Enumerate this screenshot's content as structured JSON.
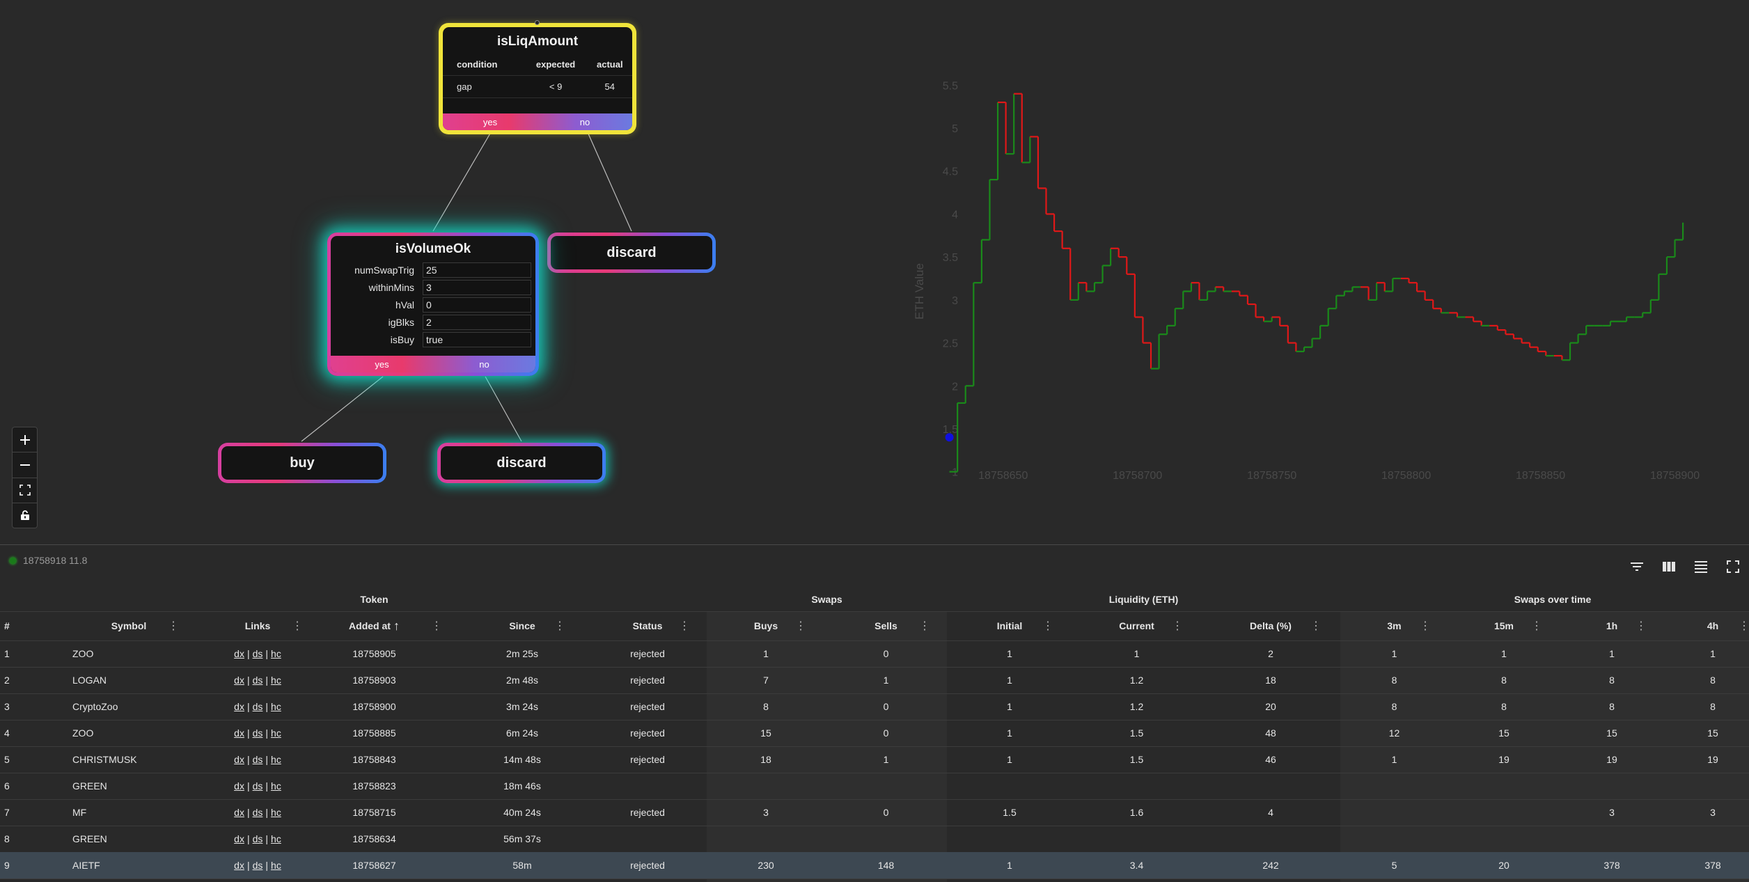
{
  "flow": {
    "root": {
      "title": "isLiqAmount",
      "columns": [
        "condition",
        "expected",
        "actual"
      ],
      "rows": [
        [
          "gap",
          "< 9",
          "54"
        ]
      ],
      "yes": "yes",
      "no": "no"
    },
    "volume": {
      "title": "isVolumeOk",
      "params": [
        {
          "label": "numSwapTrig",
          "value": "25"
        },
        {
          "label": "withinMins",
          "value": "3"
        },
        {
          "label": "hVal",
          "value": "0"
        },
        {
          "label": "igBlks",
          "value": "2"
        },
        {
          "label": "isBuy",
          "value": "true"
        }
      ],
      "yes": "yes",
      "no": "no"
    },
    "discard_top": "discard",
    "buy": "buy",
    "discard_bottom": "discard",
    "controls": [
      "plus-icon",
      "minus-icon",
      "fit-view-icon",
      "lock-icon"
    ]
  },
  "chart_data": {
    "type": "line",
    "style": "step",
    "ylabel": "ETH Value",
    "xlabel": "",
    "xlim": [
      18758627,
      18758918
    ],
    "ylim": [
      0.9,
      5.6
    ],
    "yticks": [
      "5.5",
      "5",
      "4.5",
      "4",
      "3.5",
      "3",
      "2.5",
      "2",
      "1.5",
      "1"
    ],
    "xticks": [
      "18758650",
      "18758700",
      "18758750",
      "18758800",
      "18758850",
      "18758900"
    ],
    "colors": {
      "up": "#1a8a1a",
      "down": "#e01818",
      "marker": "#1010e0"
    },
    "marker": {
      "x": 18758630,
      "y": 1.4
    },
    "x": [
      18758630,
      18758633,
      18758636,
      18758639,
      18758642,
      18758645,
      18758648,
      18758651,
      18758654,
      18758657,
      18758660,
      18758663,
      18758666,
      18758669,
      18758672,
      18758675,
      18758678,
      18758681,
      18758684,
      18758687,
      18758690,
      18758693,
      18758696,
      18758699,
      18758702,
      18758705,
      18758708,
      18758711,
      18758714,
      18758717,
      18758720,
      18758723,
      18758726,
      18758729,
      18758732,
      18758735,
      18758738,
      18758741,
      18758744,
      18758747,
      18758750,
      18758753,
      18758756,
      18758759,
      18758762,
      18758765,
      18758768,
      18758771,
      18758774,
      18758777,
      18758780,
      18758783,
      18758786,
      18758789,
      18758792,
      18758795,
      18758798,
      18758801,
      18758804,
      18758807,
      18758810,
      18758813,
      18758816,
      18758819,
      18758822,
      18758825,
      18758828,
      18758831,
      18758834,
      18758837,
      18758840,
      18758843,
      18758846,
      18758849,
      18758852,
      18758855,
      18758858,
      18758861,
      18758864,
      18758867,
      18758870,
      18758873,
      18758876,
      18758879,
      18758882,
      18758885,
      18758888,
      18758891,
      18758894,
      18758897,
      18758900,
      18758903
    ],
    "values": [
      1.0,
      1.8,
      2.0,
      3.2,
      3.7,
      4.4,
      5.3,
      4.7,
      5.4,
      4.6,
      4.9,
      4.3,
      4.0,
      3.8,
      3.6,
      3.0,
      3.2,
      3.1,
      3.2,
      3.4,
      3.6,
      3.5,
      3.3,
      2.8,
      2.5,
      2.2,
      2.6,
      2.7,
      2.9,
      3.1,
      3.2,
      3.0,
      3.1,
      3.15,
      3.1,
      3.1,
      3.05,
      2.95,
      2.8,
      2.75,
      2.8,
      2.7,
      2.5,
      2.4,
      2.45,
      2.55,
      2.7,
      2.9,
      3.05,
      3.1,
      3.15,
      3.15,
      3.0,
      3.2,
      3.1,
      3.25,
      3.25,
      3.2,
      3.1,
      3.0,
      2.9,
      2.85,
      2.85,
      2.8,
      2.8,
      2.75,
      2.7,
      2.7,
      2.65,
      2.6,
      2.55,
      2.5,
      2.45,
      2.4,
      2.35,
      2.35,
      2.3,
      2.5,
      2.6,
      2.7,
      2.7,
      2.7,
      2.75,
      2.75,
      2.8,
      2.8,
      2.85,
      3.0,
      3.3,
      3.5,
      3.7,
      3.9
    ]
  },
  "table": {
    "status_text": "18758918 11.8",
    "group_headers": [
      "Token",
      "Swaps",
      "Liquidity (ETH)",
      "Swaps over time"
    ],
    "columns": [
      "#",
      "Symbol",
      "Links",
      "Added at",
      "Since",
      "Status",
      "Buys",
      "Sells",
      "Initial",
      "Current",
      "Delta (%)",
      "3m",
      "15m",
      "1h",
      "4h"
    ],
    "link_labels": [
      "dx",
      "ds",
      "hc"
    ],
    "rows": [
      [
        "1",
        "ZOO",
        "18758905",
        "2m 25s",
        "rejected",
        "1",
        "0",
        "1",
        "1",
        "2",
        "1",
        "1",
        "1",
        "1"
      ],
      [
        "2",
        "LOGAN",
        "18758903",
        "2m 48s",
        "rejected",
        "7",
        "1",
        "1",
        "1.2",
        "18",
        "8",
        "8",
        "8",
        "8"
      ],
      [
        "3",
        "CryptoZoo",
        "18758900",
        "3m 24s",
        "rejected",
        "8",
        "0",
        "1",
        "1.2",
        "20",
        "8",
        "8",
        "8",
        "8"
      ],
      [
        "4",
        "ZOO",
        "18758885",
        "6m 24s",
        "rejected",
        "15",
        "0",
        "1",
        "1.5",
        "48",
        "12",
        "15",
        "15",
        "15"
      ],
      [
        "5",
        "CHRISTMUSK",
        "18758843",
        "14m 48s",
        "rejected",
        "18",
        "1",
        "1",
        "1.5",
        "46",
        "1",
        "19",
        "19",
        "19"
      ],
      [
        "6",
        "GREEN",
        "18758823",
        "18m 46s",
        "",
        "",
        "",
        "",
        "",
        "",
        "",
        "",
        "",
        ""
      ],
      [
        "7",
        "MF",
        "18758715",
        "40m 24s",
        "rejected",
        "3",
        "0",
        "1.5",
        "1.6",
        "4",
        "",
        "",
        "3",
        "3"
      ],
      [
        "8",
        "GREEN",
        "18758634",
        "56m 37s",
        "",
        "",
        "",
        "",
        "",
        "",
        "",
        "",
        "",
        ""
      ],
      [
        "9",
        "AIETF",
        "18758627",
        "58m",
        "rejected",
        "230",
        "148",
        "1",
        "3.4",
        "242",
        "5",
        "20",
        "378",
        "378"
      ]
    ],
    "selected_row": 8
  }
}
